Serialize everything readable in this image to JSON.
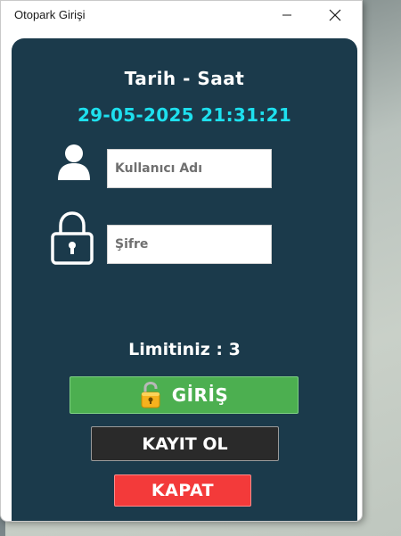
{
  "window": {
    "title": "Otopark Girişi"
  },
  "titlebar_icons": {
    "minimize": "minimize-icon",
    "close": "close-icon"
  },
  "panel": {
    "datetime_label": "Tarih -  Saat",
    "datetime_value": "29-05-2025 21:31:21",
    "username": {
      "placeholder": "Kullanıcı Adı",
      "value": "",
      "icon": "user-icon"
    },
    "password": {
      "placeholder": "Şifre",
      "value": "",
      "icon": "lock-icon"
    },
    "limit_text": "Limitiniz : 3",
    "buttons": {
      "login_label": "GİRİŞ",
      "login_icon": "unlocked-padlock-icon",
      "register_label": "KAYIT OL",
      "close_label": "KAPAT"
    }
  },
  "colors": {
    "panel_bg": "#1b3a4b",
    "datetime_accent": "#1ee0ee",
    "login_green": "#4caf50",
    "register_dark": "#2a2a2a",
    "close_red": "#f33a3a"
  }
}
